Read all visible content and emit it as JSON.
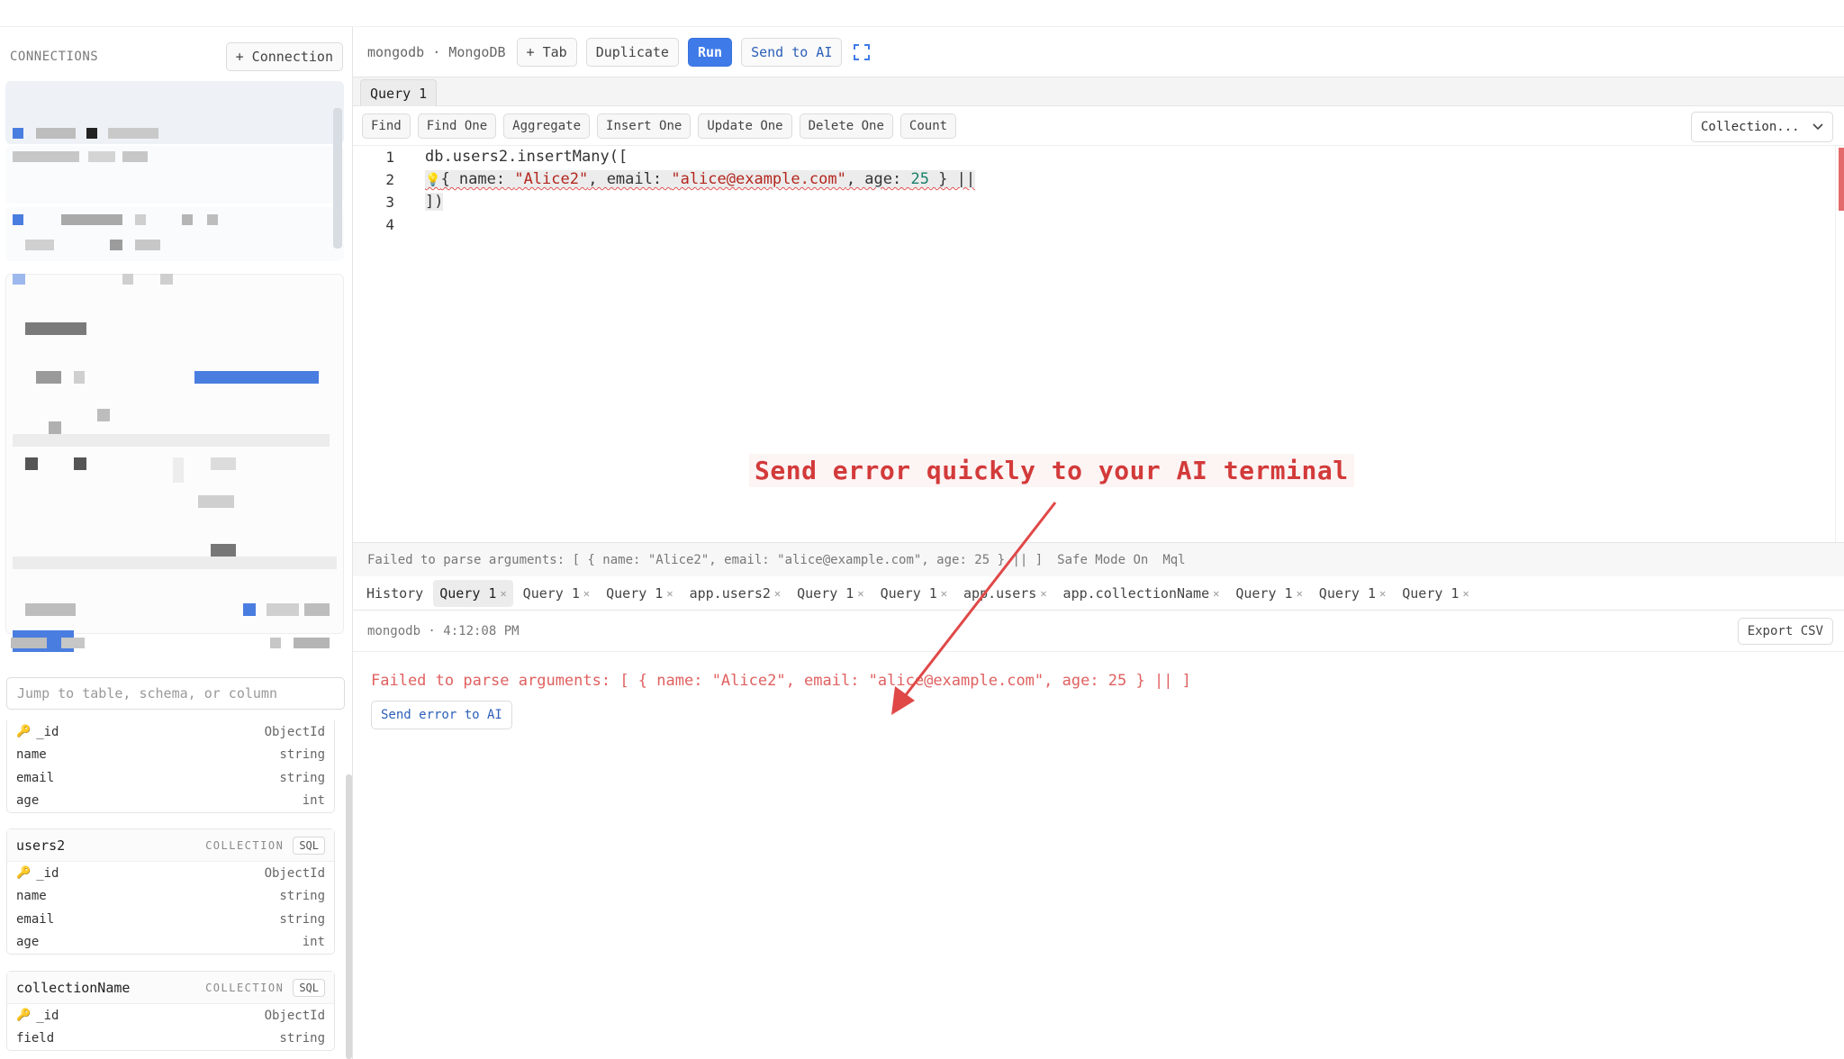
{
  "sidebar": {
    "connections_title": "CONNECTIONS",
    "add_connection_label": "+ Connection",
    "search_placeholder": "Jump to table, schema, or column",
    "partial_collection": {
      "fields": [
        {
          "name": "_id",
          "type": "ObjectId",
          "key": true
        },
        {
          "name": "name",
          "type": "string"
        },
        {
          "name": "email",
          "type": "string"
        },
        {
          "name": "age",
          "type": "int"
        }
      ]
    },
    "collections": [
      {
        "name": "users2",
        "type": "COLLECTION",
        "badge": "SQL",
        "fields": [
          {
            "name": "_id",
            "type": "ObjectId",
            "key": true
          },
          {
            "name": "name",
            "type": "string"
          },
          {
            "name": "email",
            "type": "string"
          },
          {
            "name": "age",
            "type": "int"
          }
        ]
      },
      {
        "name": "collectionName",
        "type": "COLLECTION",
        "badge": "SQL",
        "fields": [
          {
            "name": "_id",
            "type": "ObjectId",
            "key": true
          },
          {
            "name": "field",
            "type": "string"
          }
        ]
      }
    ]
  },
  "toolbar": {
    "connection_label": "mongodb · MongoDB",
    "add_tab_label": "+ Tab",
    "duplicate_label": "Duplicate",
    "run_label": "Run",
    "send_ai_label": "Send to AI"
  },
  "editor_tab": "Query 1",
  "operations": [
    "Find",
    "Find One",
    "Aggregate",
    "Insert One",
    "Update One",
    "Delete One",
    "Count"
  ],
  "collection_select": "Collection...",
  "editor": {
    "line_numbers": [
      "1",
      "2",
      "3",
      "4"
    ],
    "line1": "db.users2.insertMany([",
    "line2_open": "{ name: ",
    "line2_name": "\"Alice2\"",
    "line2_email_key": ", email: ",
    "line2_email": "\"alice@example.com\"",
    "line2_age_key": ", age: ",
    "line2_age": "25",
    "line2_close": " } ||",
    "line3": "])"
  },
  "annotation": "Send error quickly to your AI terminal",
  "status_bar": {
    "message": "Failed to parse arguments: [ { name: \"Alice2\", email: \"alice@example.com\", age: 25 } || ]",
    "safe_mode": "Safe Mode On",
    "language": "Mql"
  },
  "result_tabs": [
    {
      "label": "History",
      "closable": false,
      "active": false
    },
    {
      "label": "Query 1",
      "closable": true,
      "active": true
    },
    {
      "label": "Query 1",
      "closable": true,
      "active": false
    },
    {
      "label": "Query 1",
      "closable": true,
      "active": false
    },
    {
      "label": "app.users2",
      "closable": true,
      "active": false
    },
    {
      "label": "Query 1",
      "closable": true,
      "active": false
    },
    {
      "label": "Query 1",
      "closable": true,
      "active": false
    },
    {
      "label": "app.users",
      "closable": true,
      "active": false
    },
    {
      "label": "app.collectionName",
      "closable": true,
      "active": false
    },
    {
      "label": "Query 1",
      "closable": true,
      "active": false
    },
    {
      "label": "Query 1",
      "closable": true,
      "active": false
    },
    {
      "label": "Query 1",
      "closable": true,
      "active": false
    }
  ],
  "result": {
    "meta": "mongodb · 4:12:08 PM",
    "export_label": "Export CSV",
    "error_message": "Failed to parse arguments: [ { name: \"Alice2\", email: \"alice@example.com\", age: 25 } || ]",
    "send_error_label": "Send error to AI"
  },
  "colors": {
    "accent": "#3f7be8",
    "error": "#e06060",
    "annotation": "#d33a3a"
  }
}
